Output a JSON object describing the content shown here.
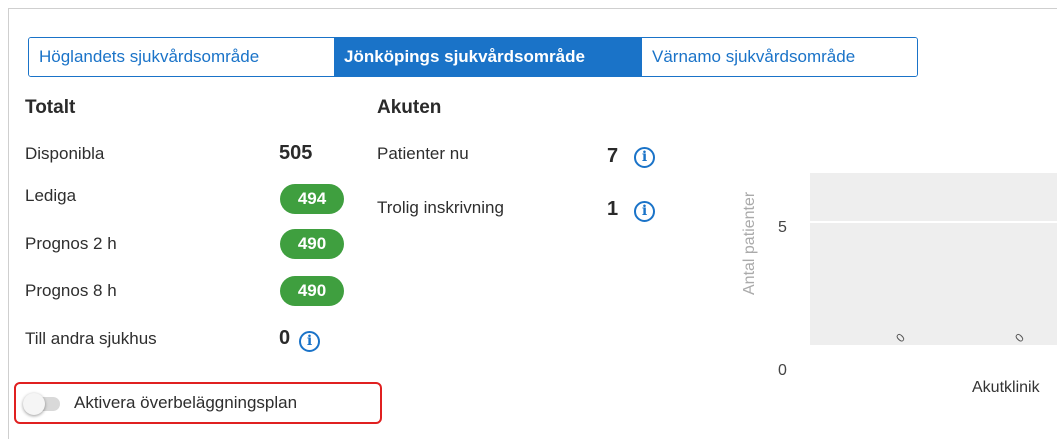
{
  "tabs": [
    {
      "label": "Höglandets sjukvårdsområde",
      "active": false
    },
    {
      "label": "Jönköpings sjukvårdsområde",
      "active": true
    },
    {
      "label": "Värnamo sjukvårdsområde",
      "active": false
    }
  ],
  "totalt": {
    "heading": "Totalt",
    "disponibla_label": "Disponibla",
    "disponibla_value": "505",
    "lediga_label": "Lediga",
    "lediga_value": "494",
    "prognos2_label": "Prognos 2 h",
    "prognos2_value": "490",
    "prognos8_label": "Prognos 8 h",
    "prognos8_value": "490",
    "andra_label": "Till andra sjukhus",
    "andra_value": "0"
  },
  "akuten": {
    "heading": "Akuten",
    "patienter_label": "Patienter nu",
    "patienter_value": "7",
    "inskrivning_label": "Trolig inskrivning",
    "inskrivning_value": "1"
  },
  "toggle": {
    "label": "Aktivera överbeläggningsplan",
    "enabled": false
  },
  "colors": {
    "accent": "#1a73c8",
    "pill_green": "#3f9f3f",
    "highlight_red": "#e02020"
  },
  "icons": {
    "info": "info-circle-icon"
  },
  "chart_data": {
    "type": "bar",
    "ylabel": "Antal patienter",
    "yticks": [
      "5",
      "0"
    ],
    "ylim": [
      0,
      6
    ],
    "categories": [
      "Akutklinik"
    ],
    "point_labels": [
      "0",
      "0"
    ],
    "grid": true
  }
}
